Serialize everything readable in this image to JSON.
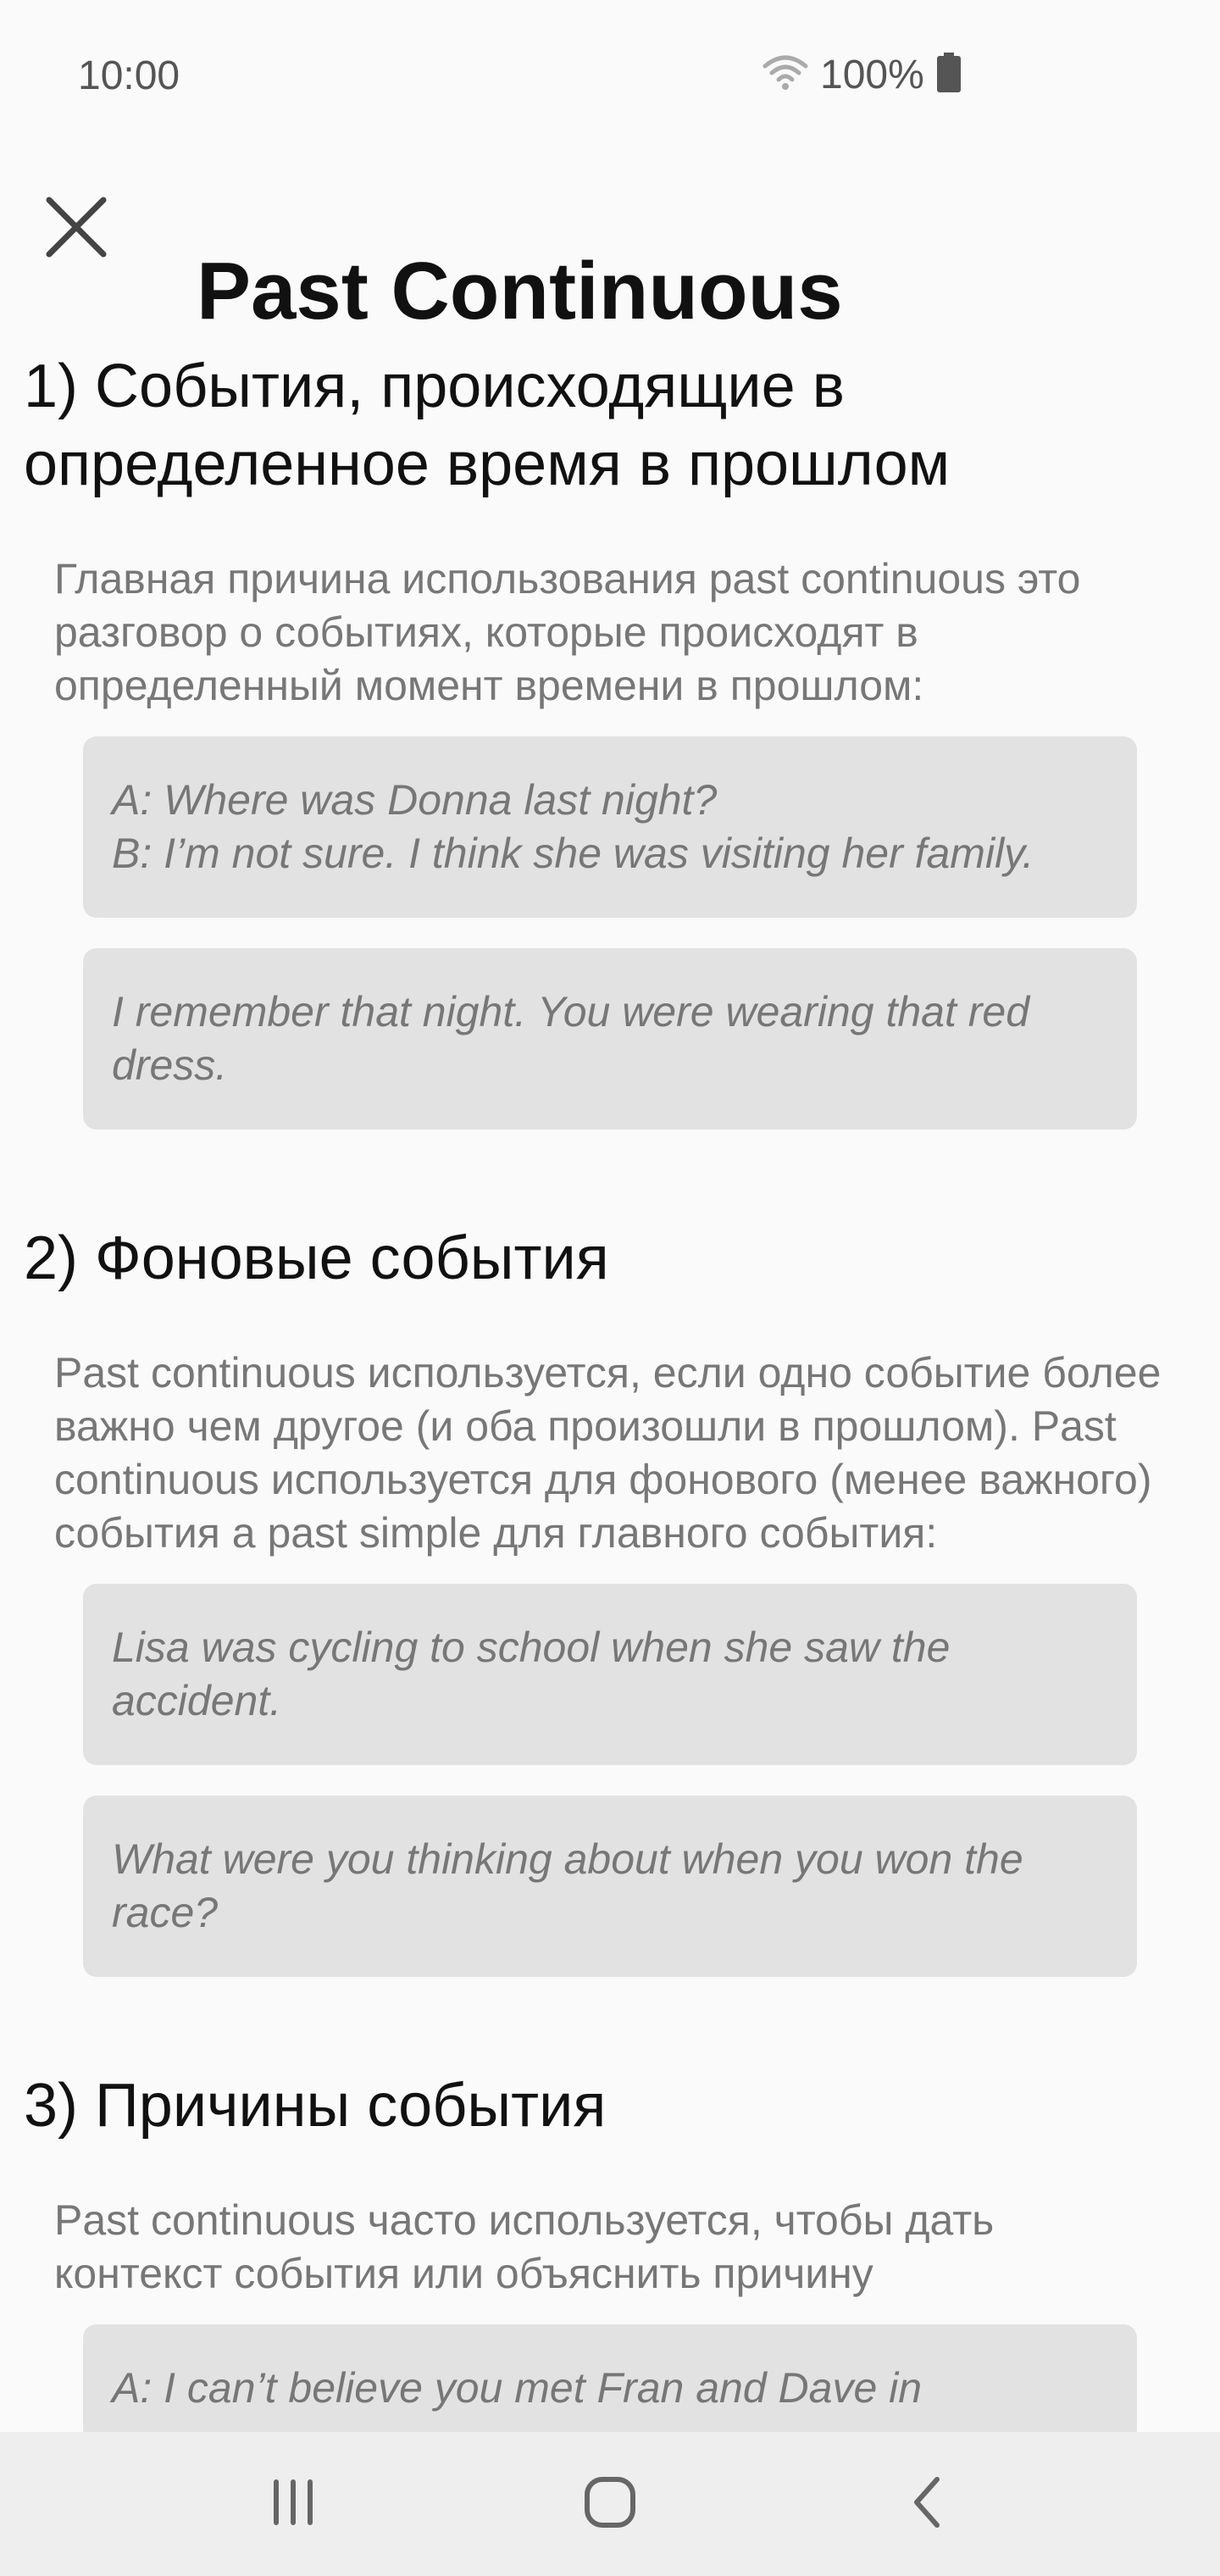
{
  "status_bar": {
    "time": "10:00",
    "battery_text": "100%",
    "icons": [
      "wifi-icon",
      "battery-icon"
    ]
  },
  "header": {
    "title": "Past Continuous",
    "close_icon": "close-icon"
  },
  "sections": [
    {
      "title": "1) События, происходящие в определенное время в прошлом",
      "description": "Главная причина использования past continuous это разговор о событиях, которые происходят в определенный момент времени в прошлом:",
      "examples": [
        [
          "A: Where was Donna last night?",
          "B: I’m not sure. I think she was visiting her family."
        ],
        [
          "I remember that night. You were wearing that red dress."
        ]
      ]
    },
    {
      "title": "2) Фоновые события",
      "description": "Past continuous используется, если одно событие более важно чем другое (и оба произошли в прошлом). Past continuous используется для фонового (менее важного) события а past simple для главного события:",
      "examples": [
        [
          "Lisa was cycling to school when she saw the accident."
        ],
        [
          "What were you thinking about when you won the race?"
        ]
      ]
    },
    {
      "title": "3) Причины события",
      "description": "Past continuous часто используется, чтобы дать контекст события или объяснить причину",
      "examples": [
        [
          "A: I can’t believe you met Fran and Dave in"
        ]
      ]
    }
  ],
  "nav_bar": {
    "buttons": [
      "recent-apps-icon",
      "home-icon",
      "back-icon"
    ]
  },
  "colors": {
    "background": "#fafafa",
    "example_background": "#e2e2e2",
    "body_text": "#777777",
    "title_text": "#111111",
    "nav_background": "#eeeeee"
  }
}
